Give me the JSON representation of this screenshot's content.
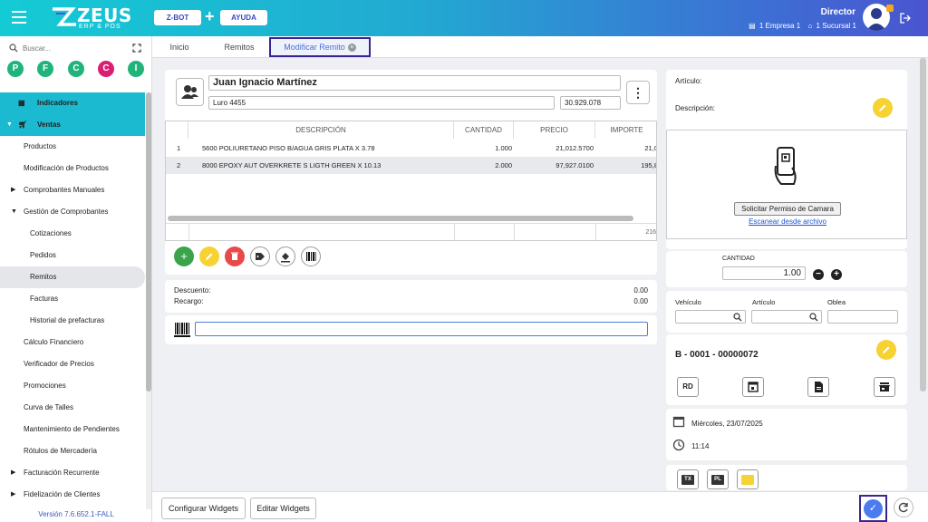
{
  "header": {
    "logo_text": "ZEUS",
    "logo_sub": "ERP & POS",
    "zbot_label": "Z-BOT",
    "ayuda_label": "AYUDA",
    "role": "Director",
    "empresa": "1 Empresa 1",
    "sucursal": "1 Sucursal 1"
  },
  "sidebar": {
    "search_placeholder": "Buscar...",
    "quick": [
      "P",
      "F",
      "C",
      "C",
      "I"
    ],
    "quick_colors": [
      "#20b47a",
      "#20b47a",
      "#20b47a",
      "#d91f73",
      "#20b47a"
    ],
    "items": [
      {
        "label": "Indicadores"
      },
      {
        "label": "Ventas"
      },
      {
        "label": "Productos"
      },
      {
        "label": "Modificación de Productos"
      },
      {
        "label": "Comprobantes Manuales"
      },
      {
        "label": "Gestión de Comprobantes"
      },
      {
        "label": "Cotizaciones"
      },
      {
        "label": "Pedidos"
      },
      {
        "label": "Remitos"
      },
      {
        "label": "Facturas"
      },
      {
        "label": "Historial de prefacturas"
      },
      {
        "label": "Cálculo Financiero"
      },
      {
        "label": "Verificador de Precios"
      },
      {
        "label": "Promociones"
      },
      {
        "label": "Curva de Talles"
      },
      {
        "label": "Mantenimiento de Pendientes"
      },
      {
        "label": "Rótulos de Mercadería"
      },
      {
        "label": "Facturación Recurrente"
      },
      {
        "label": "Fidelización de Clientes"
      }
    ],
    "version": "Versión 7.6.652.1-FALL"
  },
  "tabs": [
    {
      "label": "Inicio"
    },
    {
      "label": "Remitos"
    },
    {
      "label": "Modificar Remito"
    }
  ],
  "client": {
    "name": "Juan Ignacio Martínez",
    "address": "Luro 4455",
    "doc": "30.929.078"
  },
  "table": {
    "headers": [
      "DESCRIPCIÓN",
      "CANTIDAD",
      "PRECIO",
      "IMPORTE"
    ],
    "rows": [
      {
        "n": "1",
        "desc": "5600 POLIURETANO PISO B/AGUA GRIS PLATA X 3.78",
        "qty": "1.000",
        "price": "21,012.5700",
        "imp": "21,0"
      },
      {
        "n": "2",
        "desc": "8000 EPOXY AUT OVERKRETE S LIGTH GREEN X 10.13",
        "qty": "2.000",
        "price": "97,927.0100",
        "imp": "195,8"
      }
    ],
    "total": "216,"
  },
  "totals": {
    "descuento_label": "Descuento:",
    "descuento": "0.00",
    "recargo_label": "Recargo:",
    "recargo": "0.00"
  },
  "right": {
    "articulo_label": "Artículo:",
    "descripcion_label": "Descripción:",
    "camera_button": "Solicitar Permiso de Camara",
    "scan_link": "Escanear desde archivo",
    "cantidad_label": "CANTIDAD",
    "cantidad": "1.00",
    "vehiculo_label": "Vehículo",
    "articulo2_label": "Artículo",
    "oblea_label": "Oblea",
    "comprobante": "B - 0001 - 00000072",
    "rd_label": "RD",
    "fecha": "Miércoles, 23/07/2025",
    "hora": "11:14",
    "tx_label": "TX",
    "pl_label": "PL"
  },
  "bottom": {
    "configurar": "Configurar Widgets",
    "editar": "Editar Widgets"
  }
}
